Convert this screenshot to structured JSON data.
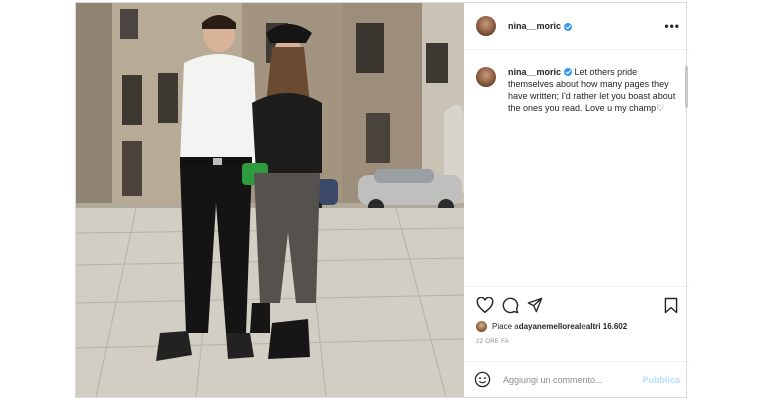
{
  "post": {
    "username": "nina__moric",
    "caption": "Let others pride themselves about how many pages they have written; I'd rather let you boast about the ones you read. Love u my champ♡",
    "likes": {
      "prefix": "Piace a ",
      "user": "dayanemelloreal",
      "middle": " e ",
      "others": "altri 16.602"
    },
    "time": "22 ORE FA",
    "comment_placeholder": "Aggiungi un commento...",
    "publish_label": "Pubblica"
  },
  "icons": {
    "more": "more-options-icon",
    "like": "heart-icon",
    "comment": "comment-icon",
    "share": "share-icon",
    "save": "bookmark-icon",
    "emoji": "emoji-icon"
  },
  "colors": {
    "verified": "#3897f0",
    "publish_disabled": "#b2dffc",
    "meta_gray": "#8e8e8e"
  }
}
